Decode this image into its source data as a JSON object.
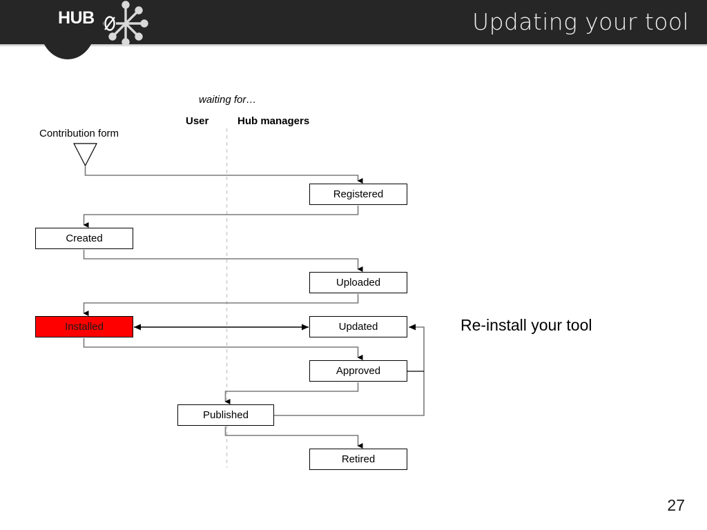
{
  "header": {
    "title": "Updating your tool",
    "logo_text": "HUB",
    "logo_zero": "0",
    "bar_color": "#262626"
  },
  "diagram": {
    "swimlane_caption": "waiting for…",
    "lanes": [
      {
        "name": "user",
        "label": "User"
      },
      {
        "name": "hub-managers",
        "label": "Hub managers"
      }
    ],
    "start_label": "Contribution form",
    "highlight_color": "#ff0000",
    "nodes": [
      {
        "id": "registered",
        "label": "Registered",
        "lane": "hub-managers",
        "highlight": false
      },
      {
        "id": "created",
        "label": "Created",
        "lane": "user",
        "highlight": false
      },
      {
        "id": "uploaded",
        "label": "Uploaded",
        "lane": "hub-managers",
        "highlight": false
      },
      {
        "id": "installed",
        "label": "Installed",
        "lane": "user",
        "highlight": true
      },
      {
        "id": "updated",
        "label": "Updated",
        "lane": "hub-managers",
        "highlight": false
      },
      {
        "id": "approved",
        "label": "Approved",
        "lane": "hub-managers",
        "highlight": false
      },
      {
        "id": "published",
        "label": "Published",
        "lane": "user",
        "highlight": false
      },
      {
        "id": "retired",
        "label": "Retired",
        "lane": "hub-managers",
        "highlight": false
      }
    ],
    "edges": [
      {
        "from": "contribution-form",
        "to": "registered"
      },
      {
        "from": "registered",
        "to": "created"
      },
      {
        "from": "created",
        "to": "uploaded"
      },
      {
        "from": "uploaded",
        "to": "installed"
      },
      {
        "from": "installed",
        "to": "updated",
        "bidirectional": true
      },
      {
        "from": "installed",
        "to": "approved"
      },
      {
        "from": "approved",
        "to": "published"
      },
      {
        "from": "published",
        "to": "updated"
      },
      {
        "from": "approved",
        "to": "updated"
      },
      {
        "from": "published",
        "to": "retired"
      }
    ]
  },
  "annotation": {
    "reinstall_note": "Re-install your tool"
  },
  "footer": {
    "page_number": "27"
  }
}
